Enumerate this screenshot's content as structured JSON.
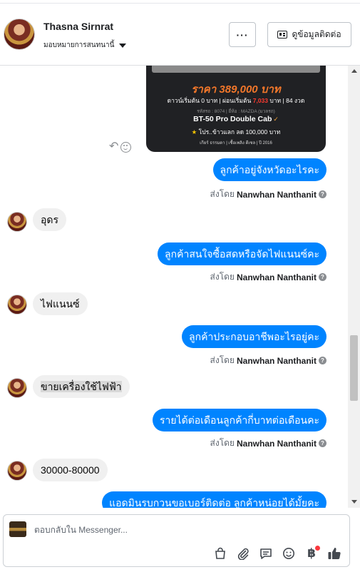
{
  "header": {
    "contact_name": "Thasna Sirnrat",
    "assign_label": "มอบหมายการสนทนานี้",
    "more_label": "···",
    "contact_info_label": "ดูข้อมูลติดต่อ"
  },
  "ad_card": {
    "price": "ราคา 389,000 บาท",
    "finance_prefix": "ดาวน์เริ่มต้น 0 บาท | ผ่อนเริ่มต้น",
    "finance_amount": "7,033",
    "finance_suffix": "บาท | 84 งวด",
    "code_line": "รหัสรถ : 8074 | ยี่ห้อ : MAZDA (มวลรถ)",
    "model": "BT-50 Pro Double Cab",
    "promo": "โปร..ข้าวแลก ลด 100,000 บาท",
    "footer": "เกียร์ ธรรมดา | เชื้อเพลิง ดีเซล | ปี 2016"
  },
  "messages": [
    {
      "side": "out",
      "text": "ลูกค้าอยู่จังหวัดอะไรคะ",
      "sent_by_prefix": "ส่งโดย",
      "sent_by": "Nanwhan Nanthanit"
    },
    {
      "side": "in",
      "text": "อุดร"
    },
    {
      "side": "out",
      "text": "ลูกค้าสนใจซื้อสดหรือจัดไฟแนนซ์คะ",
      "sent_by_prefix": "ส่งโดย",
      "sent_by": "Nanwhan Nanthanit"
    },
    {
      "side": "in",
      "text": "ไฟแนนซ์"
    },
    {
      "side": "out",
      "text": "ลูกค้าประกอบอาชีพอะไรอยู่คะ",
      "sent_by_prefix": "ส่งโดย",
      "sent_by": "Nanwhan Nanthanit"
    },
    {
      "side": "in",
      "text": "ขายเครื่องใช้ไฟฟ้า"
    },
    {
      "side": "out",
      "text": "รายได้ต่อเดือนลูกค้ากี่บาทต่อเดือนคะ",
      "sent_by_prefix": "ส่งโดย",
      "sent_by": "Nanwhan Nanthanit"
    },
    {
      "side": "in",
      "text": "30000-80000"
    },
    {
      "side": "out",
      "text": "แอดมินรบกวนขอเบอร์ติดต่อ ลูกค้าหน่อยได้มั้ยคะ"
    }
  ],
  "composer": {
    "placeholder": "ตอบกลับใน Messenger..."
  },
  "colors": {
    "outgoing_bubble": "#0084ff",
    "incoming_bubble": "#f0f0f0",
    "like": "#444950",
    "price": "#f2772a"
  }
}
